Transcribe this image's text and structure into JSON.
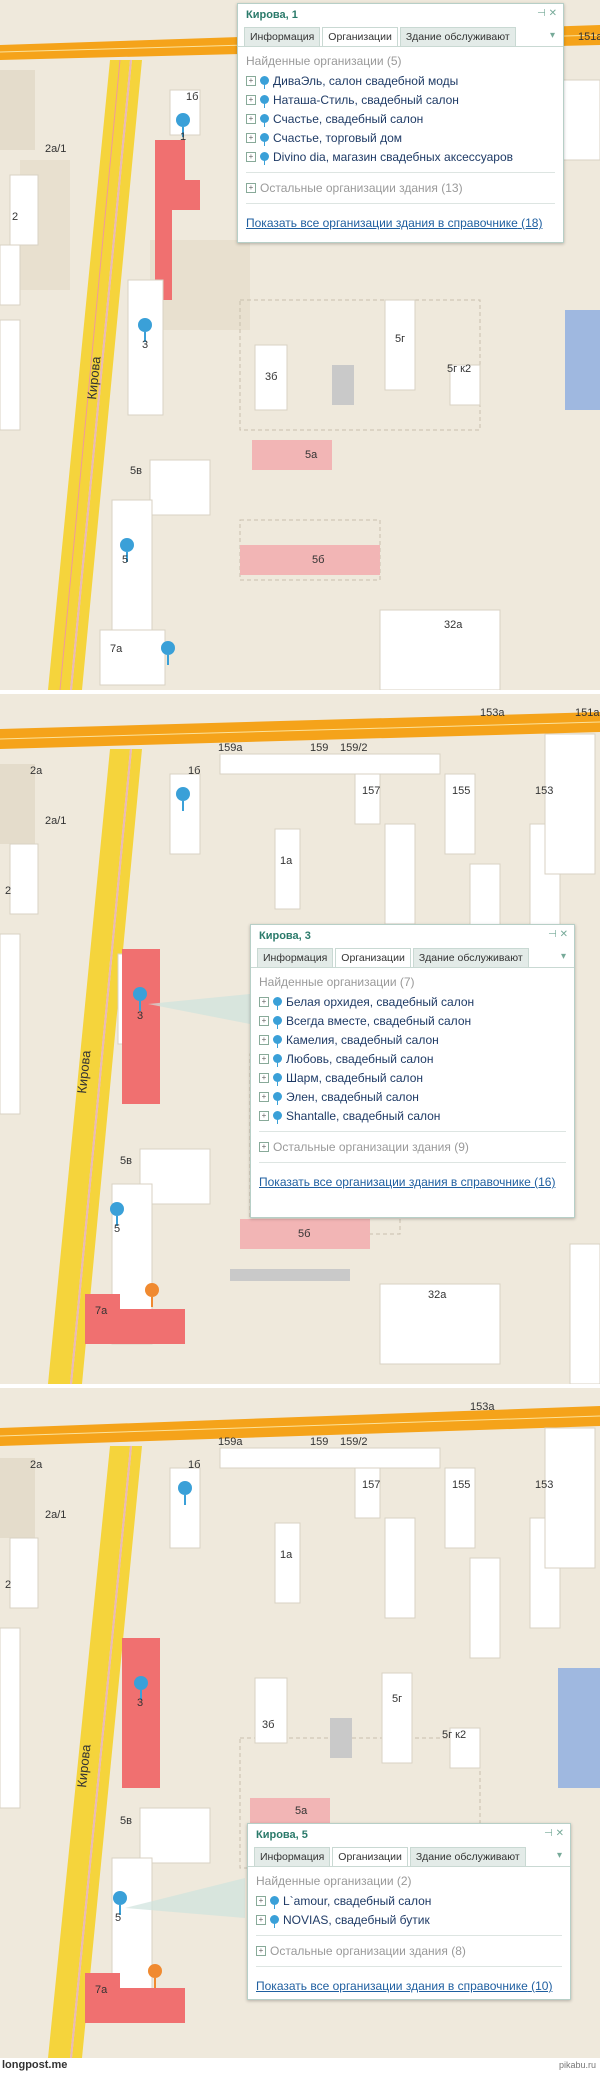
{
  "panels": [
    {
      "street": "Кирова",
      "popup": {
        "title": "Кирова, 1",
        "tabs": [
          "Информация",
          "Организации",
          "Здание обслуживают"
        ],
        "found": "Найденные организации",
        "found_count": "(5)",
        "orgs": [
          "ДиваЭль, салон свадебной моды",
          "Наташа-Стиль, свадебный салон",
          "Счастье, свадебный салон",
          "Счастье, торговый дом",
          "Divino dia, магазин свадебных аксессуаров"
        ],
        "other": "Остальные организации здания",
        "other_count": "(13)",
        "show_all": "Показать все организации здания в справочнике",
        "show_all_count": "(18)"
      },
      "labels": [
        "151а",
        "2",
        "2а/1",
        "1б",
        "1",
        "3б",
        "5г",
        "5г к2",
        "5а",
        "5б",
        "5в",
        "5",
        "7а",
        "32а",
        "3"
      ]
    },
    {
      "street": "Кирова",
      "popup": {
        "title": "Кирова, 3",
        "tabs": [
          "Информация",
          "Организации",
          "Здание обслуживают"
        ],
        "found": "Найденные организации",
        "found_count": "(7)",
        "orgs": [
          "Белая орхидея, свадебный салон",
          "Всегда вместе, свадебный салон",
          "Камелия, свадебный салон",
          "Любовь, свадебный салон",
          "Шарм, свадебный салон",
          "Элен, свадебный салон",
          "Shantalle, свадебный салон"
        ],
        "other": "Остальные организации здания",
        "other_count": "(9)",
        "show_all": "Показать все организации здания в справочнике",
        "show_all_count": "(16)"
      },
      "labels": [
        "153а",
        "151а",
        "159а",
        "159",
        "159/2",
        "157",
        "155",
        "153",
        "2а",
        "2а/1",
        "1б",
        "1а",
        "2",
        "3",
        "5в",
        "5",
        "7а",
        "5б",
        "32а"
      ]
    },
    {
      "street": "Кирова",
      "popup": {
        "title": "Кирова, 5",
        "tabs": [
          "Информация",
          "Организации",
          "Здание обслуживают"
        ],
        "found": "Найденные организации",
        "found_count": "(2)",
        "orgs": [
          "L`amour, свадебный салон",
          "NOVIAS, свадебный бутик"
        ],
        "other": "Остальные организации здания",
        "other_count": "(8)",
        "show_all": "Показать все организации здания в справочнике",
        "show_all_count": "(10)"
      },
      "labels": [
        "153а",
        "159а",
        "159",
        "159/2",
        "157",
        "155",
        "153",
        "2а",
        "2а/1",
        "1б",
        "1а",
        "2",
        "3б",
        "5г",
        "5г к2",
        "3",
        "5а",
        "5в",
        "5",
        "7а"
      ]
    }
  ],
  "footer": {
    "left": "longpost.me",
    "right": "pikabu.ru"
  },
  "colors": {
    "road": "#f5d43c",
    "arterial": "#f5a31a",
    "highlight": "#f07070",
    "pin": "#3aa0d8",
    "pin_orange": "#f08a30"
  }
}
